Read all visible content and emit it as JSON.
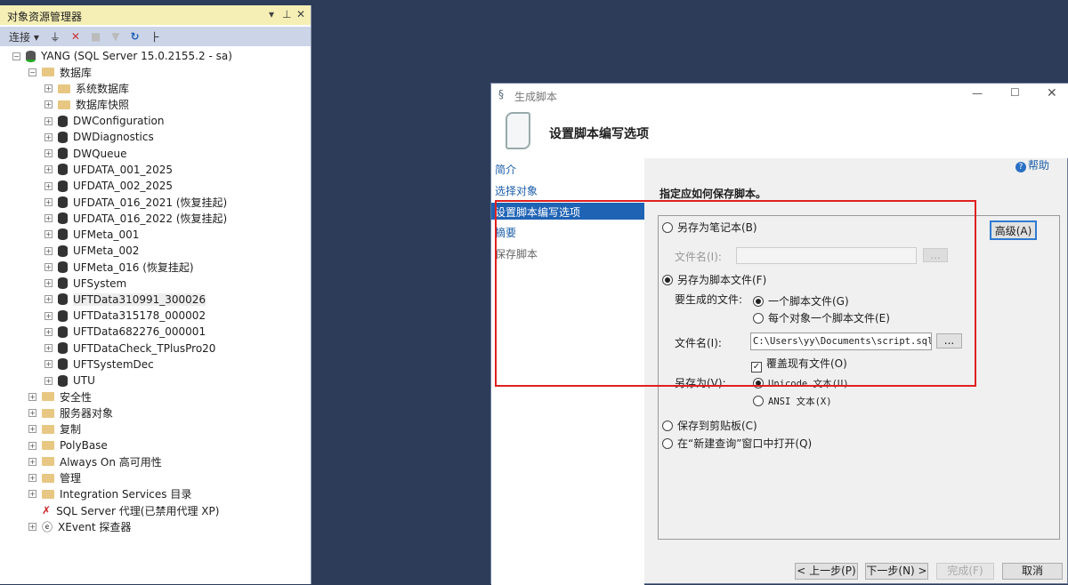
{
  "object_explorer": {
    "title": "对象资源管理器",
    "header_controls": [
      "▾",
      "⊥",
      "✕"
    ],
    "toolbar": {
      "connect": "连接"
    },
    "server": "YANG (SQL Server 15.0.2155.2 - sa)",
    "databases_folder": "数据库",
    "db_items": [
      "系统数据库",
      "数据库快照",
      "DWConfiguration",
      "DWDiagnostics",
      "DWQueue",
      "UFDATA_001_2025",
      "UFDATA_002_2025",
      "UFDATA_016_2021 (恢复挂起)",
      "UFDATA_016_2022 (恢复挂起)",
      "UFMeta_001",
      "UFMeta_002",
      "UFMeta_016 (恢复挂起)",
      "UFSystem",
      "UFTData310991_300026",
      "UFTData315178_000002",
      "UFTData682276_000001",
      "UFTDataCheck_TPlusPro20",
      "UFTSystemDec",
      "UTU"
    ],
    "server_items": [
      "安全性",
      "服务器对象",
      "复制",
      "PolyBase",
      "Always On 高可用性",
      "管理",
      "Integration Services 目录"
    ],
    "agent": "SQL Server 代理(已禁用代理 XP)",
    "xevent": "XEvent 探查器"
  },
  "dialog": {
    "title": "生成脚本",
    "header": "设置脚本编写选项",
    "help": "帮助",
    "nav": [
      "简介",
      "选择对象",
      "设置脚本编写选项",
      "摘要",
      "保存脚本"
    ],
    "instruction": "指定应如何保存脚本。",
    "opt_notebook": "另存为笔记本(B)",
    "notebook_filename_label": "文件名(I):",
    "browse": "...",
    "advanced": "高级(A)",
    "opt_script_file": "另存为脚本文件(F)",
    "files_label": "要生成的文件:",
    "one_file": "一个脚本文件(G)",
    "per_object": "每个对象一个脚本文件(E)",
    "filename_label": "文件名(I):",
    "filename_value": "C:\\Users\\yy\\Documents\\script.sql",
    "overwrite": "覆盖现有文件(O)",
    "save_as_label": "另存为(V):",
    "unicode": "Unicode 文本(U)",
    "ansi": "ANSI 文本(X)",
    "clipboard": "保存到剪贴板(C)",
    "new_query": "在“新建查询”窗口中打开(Q)",
    "prev": "< 上一步(P)",
    "next": "下一步(N) >",
    "finish": "完成(F)",
    "cancel": "取消"
  },
  "colors": {
    "highlight": "#e02020",
    "selected_nav": "#1f63b5"
  }
}
